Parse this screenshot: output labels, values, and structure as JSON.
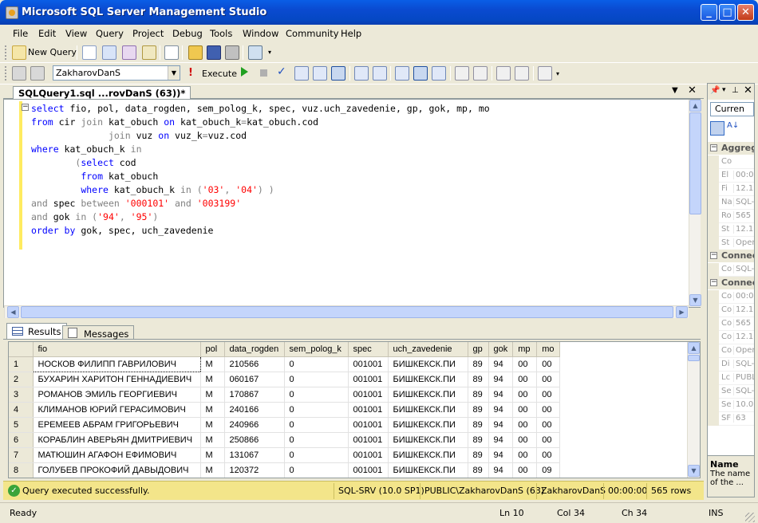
{
  "window": {
    "title": "Microsoft SQL Server Management Studio"
  },
  "menu": [
    "File",
    "Edit",
    "View",
    "Query",
    "Project",
    "Debug",
    "Tools",
    "Window",
    "Community",
    "Help"
  ],
  "toolbar": {
    "new_query": "New Query",
    "database": "ZakharovDanS",
    "execute": "Execute"
  },
  "document_tab": {
    "title": "SQLQuery1.sql ...rovDanS (63))*"
  },
  "code_lines": [
    [
      [
        "kw",
        "select "
      ],
      [
        "",
        "fio, pol, data_rogden, sem_polog_k, spec, vuz.uch_zavedenie, gp, gok, mp, mo"
      ]
    ],
    [
      [
        "kw",
        "from "
      ],
      [
        "",
        "cir "
      ],
      [
        "gr",
        "join "
      ],
      [
        "",
        "kat_obuch "
      ],
      [
        "kw",
        "on "
      ],
      [
        "",
        "kat_obuch_k"
      ],
      [
        "gr",
        "="
      ],
      [
        "",
        "kat_obuch.cod"
      ]
    ],
    [
      [
        "",
        "              "
      ],
      [
        "gr",
        "join "
      ],
      [
        "",
        "vuz "
      ],
      [
        "kw",
        "on "
      ],
      [
        "",
        "vuz_k"
      ],
      [
        "gr",
        "="
      ],
      [
        "",
        "vuz.cod"
      ]
    ],
    [
      [
        "kw",
        "where "
      ],
      [
        "",
        "kat_obuch_k "
      ],
      [
        "gr",
        "in"
      ]
    ],
    [
      [
        "",
        "        "
      ],
      [
        "gr",
        "("
      ],
      [
        "kw",
        "select "
      ],
      [
        "",
        "cod"
      ]
    ],
    [
      [
        "",
        "         "
      ],
      [
        "kw",
        "from "
      ],
      [
        "",
        "kat_obuch"
      ]
    ],
    [
      [
        "",
        "         "
      ],
      [
        "kw",
        "where "
      ],
      [
        "",
        "kat_obuch_k "
      ],
      [
        "gr",
        "in ("
      ],
      [
        "str",
        "'03'"
      ],
      [
        "gr",
        ", "
      ],
      [
        "str",
        "'04'"
      ],
      [
        "gr",
        ") )"
      ]
    ],
    [
      [
        "gr",
        "and "
      ],
      [
        "",
        "spec "
      ],
      [
        "gr",
        "between "
      ],
      [
        "str",
        "'000101' "
      ],
      [
        "gr",
        "and "
      ],
      [
        "str",
        "'003199'"
      ]
    ],
    [
      [
        "gr",
        "and "
      ],
      [
        "",
        "gok "
      ],
      [
        "gr",
        "in ("
      ],
      [
        "str",
        "'94'"
      ],
      [
        "gr",
        ", "
      ],
      [
        "str",
        "'95'"
      ],
      [
        "gr",
        ")"
      ]
    ],
    [
      [
        "kw",
        "order by "
      ],
      [
        "",
        "gok, spec, uch_zavedenie"
      ]
    ]
  ],
  "results_tabs": {
    "results": "Results",
    "messages": "Messages"
  },
  "grid": {
    "columns": [
      "fio",
      "pol",
      "data_rogden",
      "sem_polog_k",
      "spec",
      "uch_zavedenie",
      "gp",
      "gok",
      "mp",
      "mo"
    ],
    "rows": [
      [
        "1",
        "НОСКОВ ФИЛИПП ГАВРИЛОВИЧ",
        "М",
        "210566",
        "0",
        "001001",
        "БИШКЕКСК.ПИ",
        "89",
        "94",
        "00",
        "00"
      ],
      [
        "2",
        "БУХАРИН ХАРИТОН ГЕННАДИЕВИЧ",
        "М",
        "060167",
        "0",
        "001001",
        "БИШКЕКСК.ПИ",
        "89",
        "94",
        "00",
        "00"
      ],
      [
        "3",
        "РОМАНОВ ЭМИЛЬ ГЕОРГИЕВИЧ",
        "М",
        "170867",
        "0",
        "001001",
        "БИШКЕКСК.ПИ",
        "89",
        "94",
        "00",
        "00"
      ],
      [
        "4",
        "КЛИМАНОВ ЮРИЙ ГЕРАСИМОВИЧ",
        "М",
        "240166",
        "0",
        "001001",
        "БИШКЕКСК.ПИ",
        "89",
        "94",
        "00",
        "00"
      ],
      [
        "5",
        "ЕРЕМЕЕВ АБРАМ ГРИГОРЬЕВИЧ",
        "М",
        "240966",
        "0",
        "001001",
        "БИШКЕКСК.ПИ",
        "89",
        "94",
        "00",
        "00"
      ],
      [
        "6",
        "КОРАБЛИН АВЕРЬЯН ДМИТРИЕВИЧ",
        "М",
        "250866",
        "0",
        "001001",
        "БИШКЕКСК.ПИ",
        "89",
        "94",
        "00",
        "00"
      ],
      [
        "7",
        "МАТЮШИН АГАФОН ЕФИМОВИЧ",
        "М",
        "131067",
        "0",
        "001001",
        "БИШКЕКСК.ПИ",
        "89",
        "94",
        "00",
        "00"
      ],
      [
        "8",
        "ГОЛУБЕВ ПРОКОФИЙ ДАВЫДОВИЧ",
        "М",
        "120372",
        "0",
        "001001",
        "БИШКЕКСК.ПИ",
        "89",
        "94",
        "00",
        "09"
      ]
    ]
  },
  "query_status": {
    "message": "Query executed successfully.",
    "server": "SQL-SRV (10.0 SP1)",
    "login": "PUBLIC\\ZakharovDanS (63)",
    "database": "ZakharovDanS",
    "elapsed": "00:00:00",
    "rows": "565 rows"
  },
  "statusbar": {
    "ready": "Ready",
    "ln": "Ln 10",
    "col": "Col 34",
    "ch": "Ch 34",
    "mode": "INS"
  },
  "properties": {
    "combo": "Curren",
    "cat1": "Aggreg",
    "cat1_rows": [
      [
        "Co",
        ""
      ],
      [
        "El",
        "00:00"
      ],
      [
        "Fi",
        "12.11"
      ],
      [
        "Na",
        "SQL-S"
      ],
      [
        "Ro",
        "565"
      ],
      [
        "St",
        "12.11"
      ],
      [
        "St",
        "Open"
      ]
    ],
    "cat2": "Connec",
    "cat2_rows": [
      [
        "Co",
        "SQL-S"
      ]
    ],
    "cat3": "Connec",
    "cat3_rows": [
      [
        "Co",
        "00:00"
      ],
      [
        "Co",
        "12.11"
      ],
      [
        "Co",
        "565"
      ],
      [
        "Co",
        "12.11"
      ],
      [
        "Co",
        "Open"
      ],
      [
        "Di",
        "SQL-S"
      ],
      [
        "Lc",
        "PUBLI"
      ],
      [
        "Se",
        "SQL-S"
      ],
      [
        "Se",
        "10.0."
      ],
      [
        "SF",
        "63"
      ]
    ],
    "desc_title": "Name",
    "desc_text": "The name of the ..."
  }
}
